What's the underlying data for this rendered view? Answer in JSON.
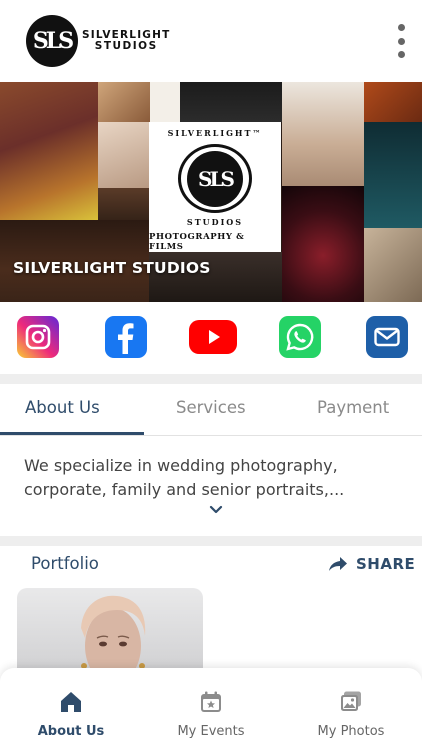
{
  "header": {
    "logo_mark": "SLS",
    "logo_line1": "SILVERLIGHT",
    "logo_line2": "STUDIOS",
    "menu_icon": "more-vertical-icon"
  },
  "banner": {
    "title": "SILVERLIGHT STUDIOS",
    "center_logo": {
      "arc_top": "SILVERLIGHT™",
      "mark": "SLS",
      "arc_bottom": "STUDIOS",
      "tagline": "PHOTOGRAPHY & FILMS"
    }
  },
  "social": [
    {
      "name": "instagram",
      "icon": "instagram-icon",
      "color": "#c13584"
    },
    {
      "name": "facebook",
      "icon": "facebook-icon",
      "color": "#1877f2"
    },
    {
      "name": "youtube",
      "icon": "youtube-icon",
      "color": "#ff0000"
    },
    {
      "name": "whatsapp",
      "icon": "whatsapp-icon",
      "color": "#25d366"
    },
    {
      "name": "email",
      "icon": "mail-icon",
      "color": "#1e5fa8"
    }
  ],
  "tabs": [
    {
      "label": "About Us",
      "active": true
    },
    {
      "label": "Services",
      "active": false
    },
    {
      "label": "Payment",
      "active": false
    }
  ],
  "about": {
    "text": "We specialize in wedding photography, corporate, family and senior portraits,..."
  },
  "portfolio": {
    "title": "Portfolio",
    "share_label": "SHARE"
  },
  "bottom_nav": [
    {
      "label": "About Us",
      "icon": "home-icon",
      "active": true
    },
    {
      "label": "My Events",
      "icon": "calendar-star-icon",
      "active": false
    },
    {
      "label": "My Photos",
      "icon": "photos-icon",
      "active": false
    }
  ],
  "colors": {
    "accent": "#2f4c6b",
    "inactive": "#8a8a8a",
    "band": "#eeeeee"
  }
}
